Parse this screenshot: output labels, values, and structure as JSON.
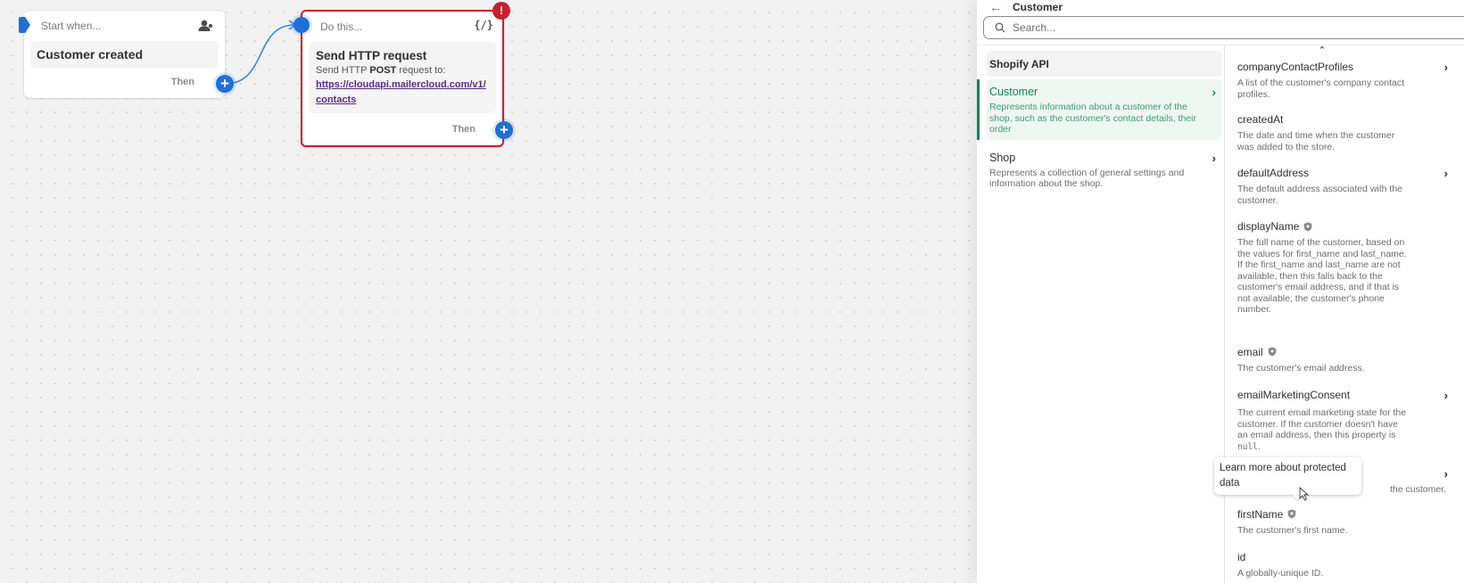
{
  "canvas": {
    "trigger": {
      "header_label": "Start when...",
      "header_icon": "customer-icon",
      "title": "Customer created",
      "then_label": "Then"
    },
    "action": {
      "header_label": "Do this...",
      "header_icon": "code-braces-icon",
      "title": "Send HTTP request",
      "subtitle_prefix": "Send HTTP ",
      "method": "POST",
      "subtitle_suffix": " request to:",
      "url": "https://cloudapi.mailercloud.com/v1/contacts",
      "then_label": "Then",
      "error_badge": "!"
    }
  },
  "panel": {
    "title": "Customer",
    "search": {
      "placeholder": "Search...",
      "value": ""
    },
    "api_header": "Shopify API",
    "objects": [
      {
        "name": "Customer",
        "description": "Represents information about a customer of the shop, such as the customer's contact details, their order",
        "selected": true
      },
      {
        "name": "Shop",
        "description": "Represents a collection of general settings and information about the shop.",
        "selected": false
      }
    ],
    "fields": [
      {
        "name": "companyContactProfiles",
        "description": "A list of the customer's company contact profiles.",
        "has_children": true,
        "protected": false
      },
      {
        "name": "createdAt",
        "description": "The date and time when the customer was added to the store.",
        "has_children": false,
        "protected": false
      },
      {
        "name": "defaultAddress",
        "description": "The default address associated with the customer.",
        "has_children": true,
        "protected": false
      },
      {
        "name": "displayName",
        "description": "The full name of the customer, based on the values for first_name and last_name. If the first_name and last_name are not available, then this falls back to the customer's email address, and if that is not available, the customer's phone number.",
        "has_children": false,
        "protected": true
      },
      {
        "name": "email",
        "description": "The customer's email address.",
        "has_children": false,
        "protected": true
      },
      {
        "name": "emailMarketingConsent",
        "description_prefix": "The current email marketing state for the customer. If the customer doesn't have an email address, then this property is ",
        "description_code": "null",
        "description_suffix": ".",
        "has_children": true,
        "protected": false
      },
      {
        "name": "",
        "description": "the customer.",
        "has_children": true,
        "protected": false
      },
      {
        "name": "firstName",
        "description": "The customer's first name.",
        "has_children": false,
        "protected": true
      },
      {
        "name": "id",
        "description": "A globally-unique ID.",
        "has_children": false,
        "protected": false
      }
    ],
    "tooltip": "Learn more about protected data"
  },
  "colors": {
    "accent_blue": "#1f6fd8",
    "error_red": "#c8202f",
    "selected_green": "#1a7f5a",
    "link_purple": "#5b2a86"
  }
}
